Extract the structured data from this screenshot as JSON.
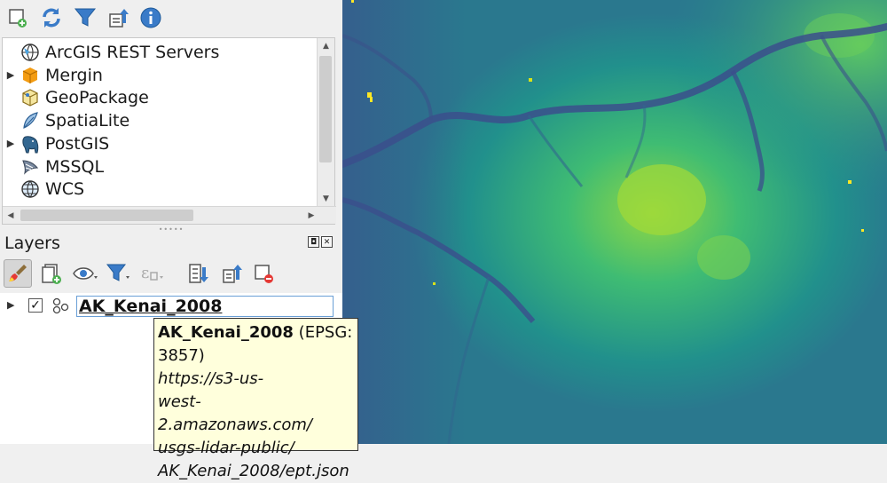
{
  "browser": {
    "items": [
      {
        "label": "ArcGIS REST Servers",
        "icon": "globe-arcgis-icon",
        "expandable": false
      },
      {
        "label": "Mergin",
        "icon": "cube-icon",
        "expandable": true
      },
      {
        "label": "GeoPackage",
        "icon": "geopackage-icon",
        "expandable": false
      },
      {
        "label": "SpatiaLite",
        "icon": "feather-icon",
        "expandable": false
      },
      {
        "label": "PostGIS",
        "icon": "elephant-icon",
        "expandable": true
      },
      {
        "label": "MSSQL",
        "icon": "mssql-icon",
        "expandable": false
      },
      {
        "label": "WCS",
        "icon": "globe-icon",
        "expandable": false
      }
    ]
  },
  "layers": {
    "title": "Layers",
    "layer": {
      "name": "AK_Kenai_2008",
      "checked": true
    }
  },
  "tooltip": {
    "name": "AK_Kenai_2008",
    "crs": " (EPSG: 3857)",
    "uri_lines": [
      "https://s3-us-",
      "west-2.amazonaws.com/",
      "usgs-lidar-public/",
      "AK_Kenai_2008/ept.json"
    ]
  },
  "colors": {
    "map_low": "#3b4f8c",
    "map_mid": "#21908c",
    "map_high": "#8fd744",
    "map_peak": "#fde725",
    "selection_border": "#6a9fd6",
    "tooltip_bg": "#ffffdc"
  }
}
